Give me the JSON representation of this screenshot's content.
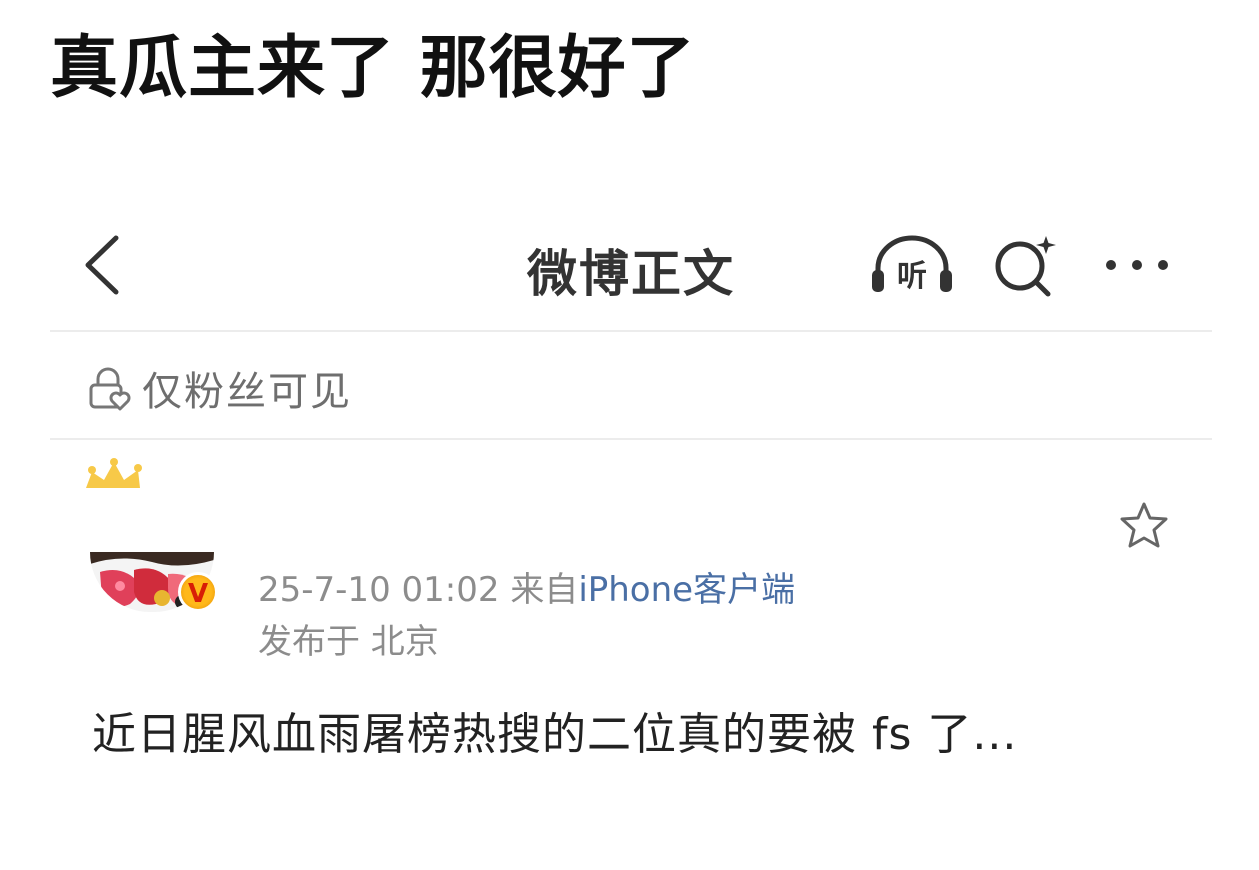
{
  "caption": "真瓜主来了 那很好了",
  "nav": {
    "title": "微博正文",
    "listen_label": "听"
  },
  "visibility": {
    "label": "仅粉丝可见"
  },
  "post": {
    "timestamp": "25-7-10 01:02",
    "from_prefix": "来自",
    "source": "iPhone客户端",
    "location": "发布于 北京",
    "verified_badge": "V",
    "text": "近日腥风血雨屠榜热搜的二位真的要被 fs 了..."
  },
  "colors": {
    "source_link": "#4a6fa5",
    "badge": "#f5a011",
    "meta": "#8c8c8c"
  }
}
